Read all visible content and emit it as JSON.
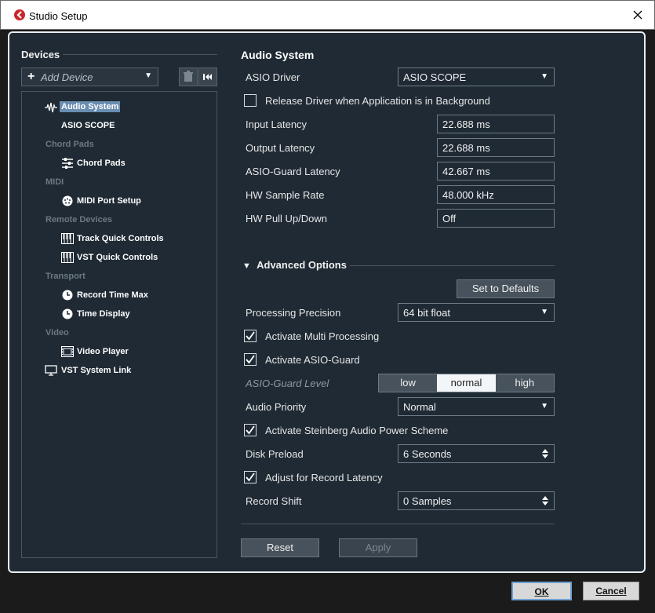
{
  "window": {
    "title": "Studio Setup"
  },
  "left": {
    "devices_label": "Devices",
    "add_device": "Add Device",
    "tree": [
      {
        "kind": "node",
        "label": "Audio System",
        "icon": "waveform-icon",
        "selected": true
      },
      {
        "kind": "node",
        "label": "ASIO SCOPE",
        "icon": ""
      },
      {
        "kind": "cat",
        "label": "Chord Pads"
      },
      {
        "kind": "node",
        "label": "Chord Pads",
        "icon": "sliders-icon"
      },
      {
        "kind": "cat",
        "label": "MIDI"
      },
      {
        "kind": "node",
        "label": "MIDI Port Setup",
        "icon": "midi-port-icon"
      },
      {
        "kind": "cat",
        "label": "Remote Devices"
      },
      {
        "kind": "node",
        "label": "Track Quick Controls",
        "icon": "keyboard-icon"
      },
      {
        "kind": "node",
        "label": "VST Quick Controls",
        "icon": "keyboard-icon"
      },
      {
        "kind": "cat",
        "label": "Transport"
      },
      {
        "kind": "node",
        "label": "Record Time Max",
        "icon": "clock-icon"
      },
      {
        "kind": "node",
        "label": "Time Display",
        "icon": "clock-icon"
      },
      {
        "kind": "cat",
        "label": "Video"
      },
      {
        "kind": "node",
        "label": "Video Player",
        "icon": "film-icon"
      },
      {
        "kind": "node",
        "label": "VST System Link",
        "icon": "monitor-icon"
      }
    ]
  },
  "right": {
    "title": "Audio System",
    "asio_driver_label": "ASIO Driver",
    "asio_driver_value": "ASIO SCOPE",
    "release_driver_label": "Release Driver when Application is in Background",
    "release_driver_checked": false,
    "input_latency_label": "Input Latency",
    "input_latency_value": "22.688 ms",
    "output_latency_label": "Output Latency",
    "output_latency_value": "22.688 ms",
    "asio_guard_latency_label": "ASIO-Guard Latency",
    "asio_guard_latency_value": "42.667 ms",
    "hw_sample_rate_label": "HW Sample Rate",
    "hw_sample_rate_value": "48.000 kHz",
    "hw_pull_label": "HW Pull Up/Down",
    "hw_pull_value": "Off",
    "advanced_label": "Advanced Options",
    "set_defaults": "Set to Defaults",
    "processing_precision_label": "Processing Precision",
    "processing_precision_value": "64 bit float",
    "multi_processing_label": "Activate Multi Processing",
    "asio_guard_label": "Activate ASIO-Guard",
    "asio_guard_level_label": "ASIO-Guard Level",
    "asio_guard_levels": [
      "low",
      "normal",
      "high"
    ],
    "asio_guard_level_selected": "normal",
    "audio_priority_label": "Audio Priority",
    "audio_priority_value": "Normal",
    "power_scheme_label": "Activate Steinberg Audio Power Scheme",
    "disk_preload_label": "Disk Preload",
    "disk_preload_value": "6 Seconds",
    "adjust_latency_label": "Adjust for Record Latency",
    "record_shift_label": "Record Shift",
    "record_shift_value": "0 Samples",
    "reset": "Reset",
    "apply": "Apply"
  },
  "footer": {
    "ok": "OK",
    "cancel": "Cancel"
  },
  "colors": {
    "panel": "#1f2a34",
    "selection": "#6a8db0",
    "accent_border": "#6ea0d0"
  }
}
